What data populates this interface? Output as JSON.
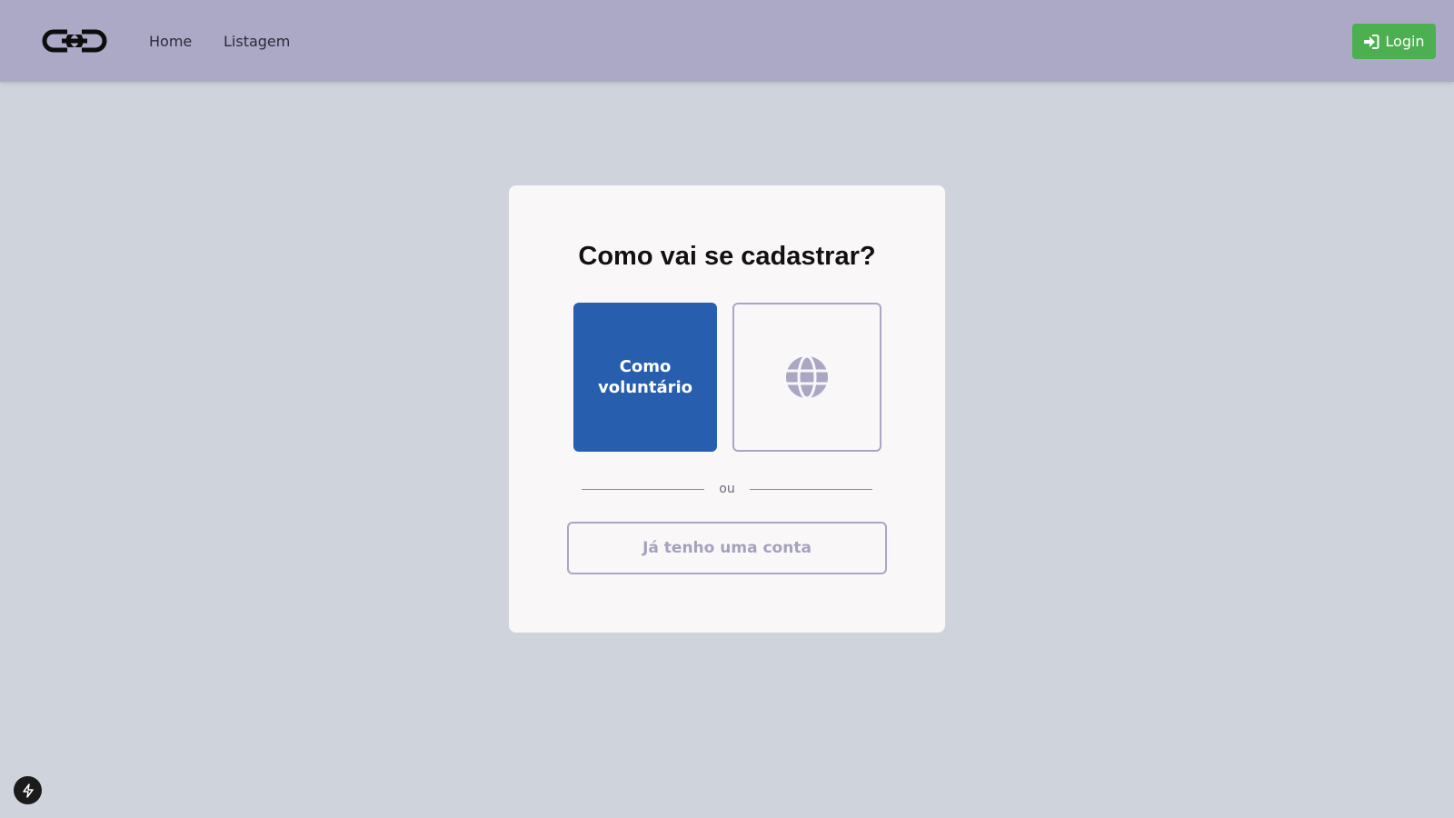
{
  "nav": {
    "logo_icon": "chain-link-logo",
    "links": [
      {
        "label": "Home"
      },
      {
        "label": "Listagem"
      }
    ],
    "login": {
      "label": "Login",
      "icon": "sign-in-icon",
      "color": "#4caf50"
    }
  },
  "card": {
    "title": "Como vai se cadastrar?",
    "options": [
      {
        "label": "Como voluntário",
        "color": "#275eae"
      },
      {
        "icon": "globe-icon",
        "border_color": "#a9a7c3"
      }
    ],
    "divider_text": "ou",
    "existing_account_label": "Já tenho uma conta"
  },
  "dev_indicator_icon": "lightning-bolt-icon",
  "colors": {
    "navbar": "#aca9c7",
    "background": "#cfd3dc",
    "card": "#faf7f9"
  }
}
